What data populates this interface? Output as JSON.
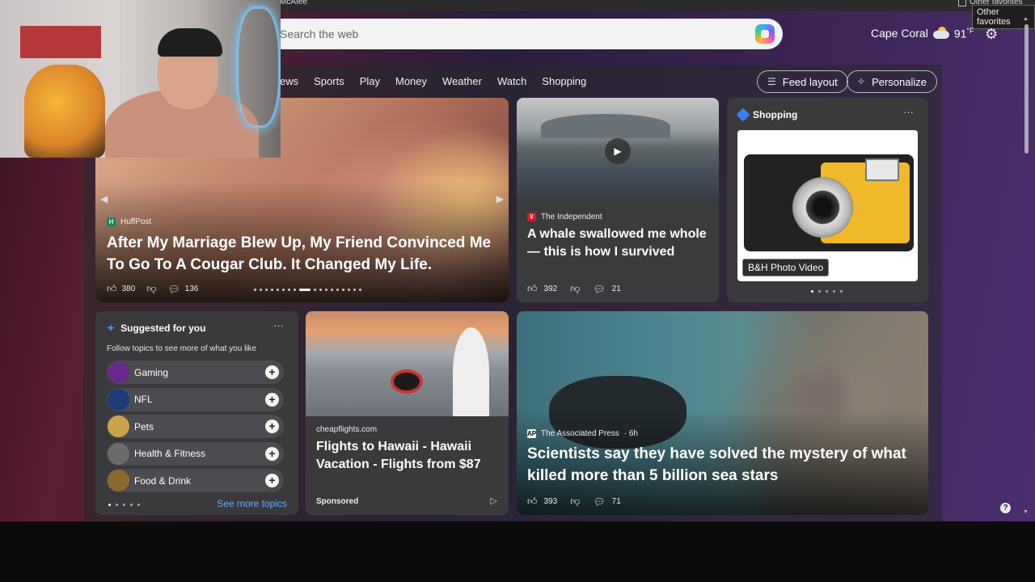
{
  "browser": {
    "tab_fragment": "McAfee",
    "other_favorites": "Other favorites",
    "tooltip": "Other favorites"
  },
  "search": {
    "placeholder": "Search the web"
  },
  "weather": {
    "city": "Cape Coral",
    "temp": "91",
    "unit": "°F"
  },
  "nav": {
    "items": [
      "News",
      "Sports",
      "Play",
      "Money",
      "Weather",
      "Watch",
      "Shopping"
    ],
    "visible_first": "ews"
  },
  "buttons": {
    "feed_layout": "Feed layout",
    "personalize": "Personalize"
  },
  "hero": {
    "source": "HuffPost",
    "title": "After My Marriage Blew Up, My Friend Convinced Me To Go To A Cougar Club. It Changed My Life.",
    "likes": "380",
    "comments": "136"
  },
  "independent": {
    "source": "The Independent",
    "title": "A whale swallowed me whole — this is how I survived",
    "likes": "392",
    "comments": "21"
  },
  "shopping": {
    "header": "Shopping",
    "product_badge": "B&H Photo Video"
  },
  "suggested": {
    "header": "Suggested for you",
    "subtitle": "Follow topics to see more of what you like",
    "topics": [
      {
        "label": "Gaming",
        "color": "#6a2a8c"
      },
      {
        "label": "NFL",
        "color": "#1d3b78"
      },
      {
        "label": "Pets",
        "color": "#c9a24a"
      },
      {
        "label": "Health & Fitness",
        "color": "#6b6b6b"
      },
      {
        "label": "Food & Drink",
        "color": "#8b6a2f"
      }
    ],
    "see_more": "See more topics"
  },
  "flights": {
    "source": "cheapflights.com",
    "title": "Flights to Hawaii - Hawaii Vacation - Flights from $87",
    "sponsored": "Sponsored"
  },
  "seastars": {
    "source": "The Associated Press",
    "age": "· 6h",
    "title": "Scientists say they have solved the mystery of what killed more than 5 billion sea stars",
    "likes": "393",
    "comments": "71"
  },
  "colors": {
    "accent_link": "#6aa9ff",
    "huffpost": "#0b8a5b",
    "independent": "#e3132c"
  }
}
